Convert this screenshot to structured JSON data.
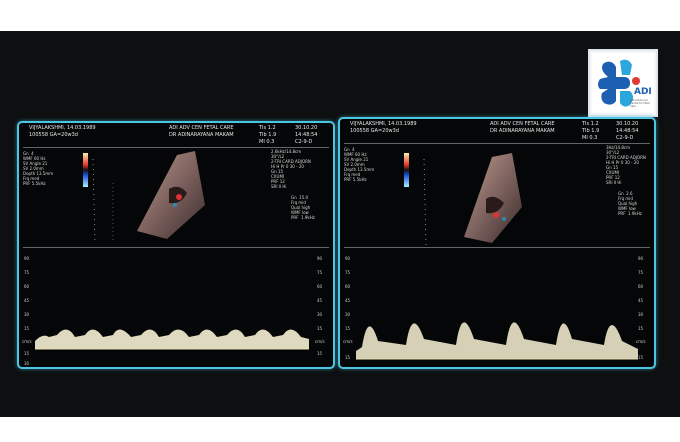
{
  "logo": {
    "text": "ADI",
    "sub": "ADI Advanced Centre for Fetal Care"
  },
  "panels": [
    {
      "patient": "VIJYALAKSHMI,  14.03.1989",
      "id": "100558  GA=20w3d",
      "center": "ADI ADV CEN FETAL CARE",
      "doctor": "DR ADINARAYANA MAKAM",
      "tis": "TIs  1.2",
      "tib": "TIb  1.9",
      "mi": "MI  0.3",
      "date": "30.10.20",
      "time": "14:48:54",
      "probe": "C2-9-D",
      "right_params": "2.6kHz/14.8cm\n30°/L2\n2-TRI CARD ADJORN\nHi H Pr 0 30 - 20\nGn 15\nCXUMI\nPRF 12\nSRI II Hi",
      "left_params": "Gn  4\nWMF 60 Hz\nSV Angle 21\nSV 2.0mm\nDepth 13.5mm\nFrq med\nPRF 5.5kHz",
      "right2_params": "Gn  15.0\nFrq mid\nQual high\nWMF low\nPRF  1.9kHz",
      "scale_left": [
        "90",
        "75",
        "60",
        "45",
        "30",
        "15",
        "cm/s",
        "15",
        "30"
      ],
      "scale_right": [
        "90",
        "75",
        "60",
        "45",
        "30",
        "15",
        "cm/s",
        "15"
      ]
    },
    {
      "patient": "VIJYALAKSHMI,  14.03.1989",
      "id": "100558  GA=20w3d",
      "center": "ADI ADV CEN FETAL CARE",
      "doctor": "DR ADINARAYANA MAKAM",
      "tis": "TIs  1.2",
      "tib": "TIb  1.9",
      "mi": "MI  0.3",
      "date": "30.10.20",
      "time": "14:48:54",
      "probe": "C2-9-D",
      "right_params": "3Hz/14.8cm\n30°/L2\n2-TRI CARD ADJORN\nHi H Pr 0 30 - 20\nGn 15\nCXUMI\nPRF 12\nSRI II Hi",
      "left_params": "Gn  4\nWMF 60 Hz\nSV Angle 21\nSV 2.0mm\nDepth 13.5mm\nFrq med\nPRF 5.5kHz",
      "right2_params": "Gn  2.6\nFrq mid\nQual high\nWMF low\nPRF  1.9kHz",
      "scale_left": [
        "90",
        "75",
        "60",
        "45",
        "30",
        "15",
        "cm/s",
        "15"
      ],
      "scale_right": [
        "90",
        "75",
        "60",
        "45",
        "30",
        "15",
        "cm/s",
        "15"
      ]
    }
  ]
}
